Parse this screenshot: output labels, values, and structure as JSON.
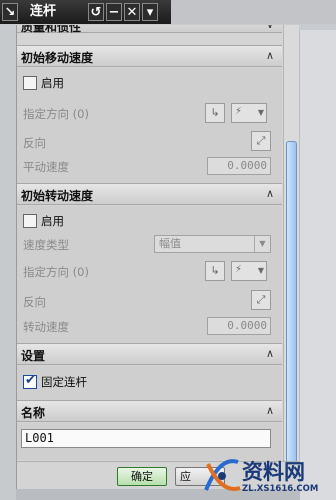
{
  "window": {
    "title": "连杆",
    "obscured_top_label": "质量和惯性"
  },
  "sections": {
    "initial_move": {
      "title": "初始移动速度",
      "enable_label": "启用",
      "direction_label": "指定方向 (0)",
      "reverse_label": "反向",
      "speed_label": "平动速度",
      "speed_value": "0.0000"
    },
    "initial_rotate": {
      "title": "初始转动速度",
      "enable_label": "启用",
      "type_label": "速度类型",
      "type_value": "幅值",
      "direction_label": "指定方向 (0)",
      "reverse_label": "反向",
      "speed_label": "转动速度",
      "speed_value": "0.0000"
    },
    "settings": {
      "title": "设置",
      "fix_link_label": "固定连杆",
      "fix_link_checked": true
    },
    "name": {
      "title": "名称",
      "value": "L001"
    }
  },
  "buttons": {
    "ok": "确定",
    "apply": "应"
  },
  "watermark": {
    "text": "资料网",
    "url": "ZL.XS1616.COM"
  },
  "colors": {
    "scroll_thumb": "#9cc2f0",
    "ok_button": "#b8dfae",
    "title_bar": "#1b1b1b"
  }
}
